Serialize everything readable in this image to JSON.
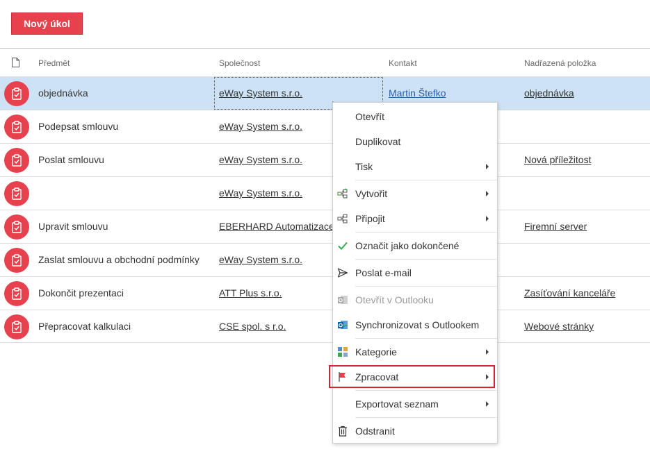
{
  "toolbar": {
    "new_task_label": "Nový úkol"
  },
  "grid": {
    "columns": {
      "subject": "Předmět",
      "company": "Společnost",
      "contact": "Kontakt",
      "parent": "Nadřazená položka"
    },
    "rows": [
      {
        "subject": "objednávka",
        "company": "eWay System s.r.o.",
        "contact": "Martin Štefko",
        "parent": "objednávka",
        "selected": true
      },
      {
        "subject": "Podepsat smlouvu",
        "company": "eWay System s.r.o.",
        "contact": "",
        "parent": ""
      },
      {
        "subject": "Poslat smlouvu",
        "company": "eWay System s.r.o.",
        "contact": "",
        "parent": "Nová příležitost"
      },
      {
        "subject": "",
        "company": "eWay System s.r.o.",
        "contact": "",
        "parent": ""
      },
      {
        "subject": "Upravit smlouvu",
        "company": "EBERHARD Automatizace s",
        "contact": "",
        "parent": "Firemní server"
      },
      {
        "subject": "Zaslat smlouvu a obchodní podmínky",
        "company": "eWay System s.r.o.",
        "contact": "",
        "parent": ""
      },
      {
        "subject": "Dokončit prezentaci",
        "company": "ATT Plus s.r.o.",
        "contact": "",
        "parent": "Zasíťování kanceláře"
      },
      {
        "subject": "Přepracovat kalkulaci",
        "company": "CSE spol. s r.o.",
        "contact": "",
        "parent": "Webové stránky"
      }
    ]
  },
  "context_menu": {
    "open": "Otevřít",
    "duplicate": "Duplikovat",
    "print": "Tisk",
    "create": "Vytvořit",
    "attach": "Připojit",
    "mark_done": "Označit jako dokončené",
    "send_email": "Poslat e-mail",
    "open_outlook": "Otevřít v Outlooku",
    "sync_outlook": "Synchronizovat s Outlookem",
    "category": "Kategorie",
    "process": "Zpracovat",
    "export_list": "Exportovat seznam",
    "delete": "Odstranit"
  },
  "colors": {
    "accent": "#e8414e",
    "selected_row": "#cde3f5",
    "highlight_border": "#d3242f",
    "check_green": "#3aa757"
  },
  "icons": {
    "header": "document-icon",
    "row": "clipboard-task-icon",
    "menu": [
      "create-icon",
      "attach-icon",
      "checkmark-icon",
      "send-icon",
      "outlook-open-icon",
      "outlook-sync-icon",
      "category-icon",
      "flag-icon",
      "trash-icon"
    ]
  }
}
